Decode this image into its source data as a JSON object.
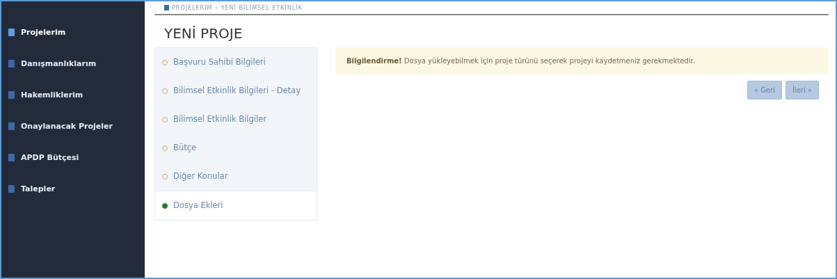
{
  "sidebar": {
    "items": [
      {
        "label": "Projelerim",
        "selected": true
      },
      {
        "label": "Danışmanlıklarım",
        "selected": false
      },
      {
        "label": "Hakemliklerim",
        "selected": false
      },
      {
        "label": "Onaylanacak Projeler",
        "selected": false
      },
      {
        "label": "APDP Bütçesi",
        "selected": false
      },
      {
        "label": "Talepler",
        "selected": false
      }
    ]
  },
  "breadcrumb": [
    "PROJELERIM",
    "YENİ BİLİMSEL ETKİNLİK"
  ],
  "breadcrumb_separator": "›",
  "title": "YENİ PROJE",
  "steps": [
    {
      "label": "Başvuru Sahibi Bilgileri",
      "selected": false
    },
    {
      "label": "Bilimsel Etkinlik Bilgileri - Detay",
      "selected": false
    },
    {
      "label": "Bilimsel Etkinlik Bilgiler",
      "selected": false
    },
    {
      "label": "Bütçe",
      "selected": false
    },
    {
      "label": "Diğer Konular",
      "selected": false
    },
    {
      "label": "Dosya Ekleri",
      "selected": true
    }
  ],
  "alert": {
    "text": "**Bilgilendirme!** Dosya yükleyebilmek için proje türünü seçerek projeyi kaydetmeniz gerekmektedir."
  },
  "buttons": [
    {
      "label": "« Geri",
      "disabled": true
    },
    {
      "label": "İleri »",
      "disabled": true
    }
  ]
}
